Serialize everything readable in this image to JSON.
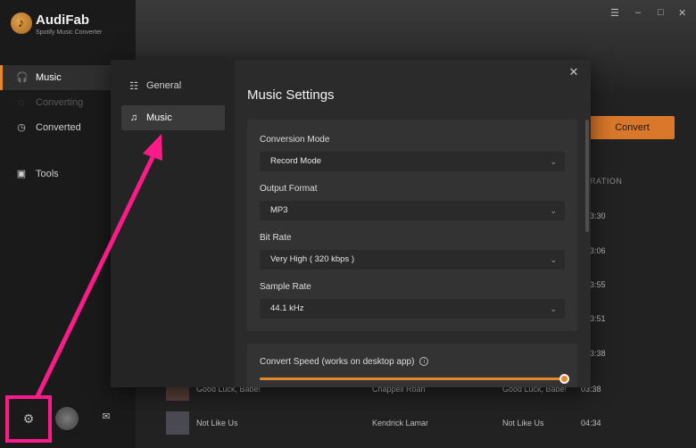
{
  "app": {
    "name": "AudiFab",
    "subtitle": "Spotify Music Converter"
  },
  "sidebar": {
    "items": [
      {
        "label": "Music",
        "icon": "headphones-icon"
      },
      {
        "label": "Converting",
        "icon": "converting-icon"
      },
      {
        "label": "Converted",
        "icon": "clock-icon"
      },
      {
        "label": "Tools",
        "icon": "toolbox-icon"
      }
    ]
  },
  "main": {
    "convert_label": "Convert",
    "duration_header": "RATION",
    "durations": [
      "3:30",
      "3:06",
      "3:55",
      "3:51",
      "3:38"
    ],
    "tracks": [
      {
        "title": "Good Luck, Babe!",
        "artist": "Chappell Roan",
        "album": "Good Luck, Babe!",
        "duration": "03:38"
      },
      {
        "title": "Not Like Us",
        "artist": "Kendrick Lamar",
        "album": "Not Like Us",
        "duration": "04:34"
      }
    ]
  },
  "modal": {
    "nav": [
      {
        "label": "General",
        "icon": "sliders-icon"
      },
      {
        "label": "Music",
        "icon": "music-note-icon"
      }
    ],
    "title": "Music Settings",
    "fields": [
      {
        "label": "Conversion Mode",
        "value": "Record Mode"
      },
      {
        "label": "Output Format",
        "value": "MP3"
      },
      {
        "label": "Bit Rate",
        "value": "Very High ( 320 kbps )"
      },
      {
        "label": "Sample Rate",
        "value": "44.1 kHz"
      }
    ],
    "speed": {
      "label": "Convert Speed (works on desktop app)",
      "level": 1.0
    }
  },
  "colors": {
    "accent": "#e5872c",
    "annotation": "#ff1a8a"
  }
}
